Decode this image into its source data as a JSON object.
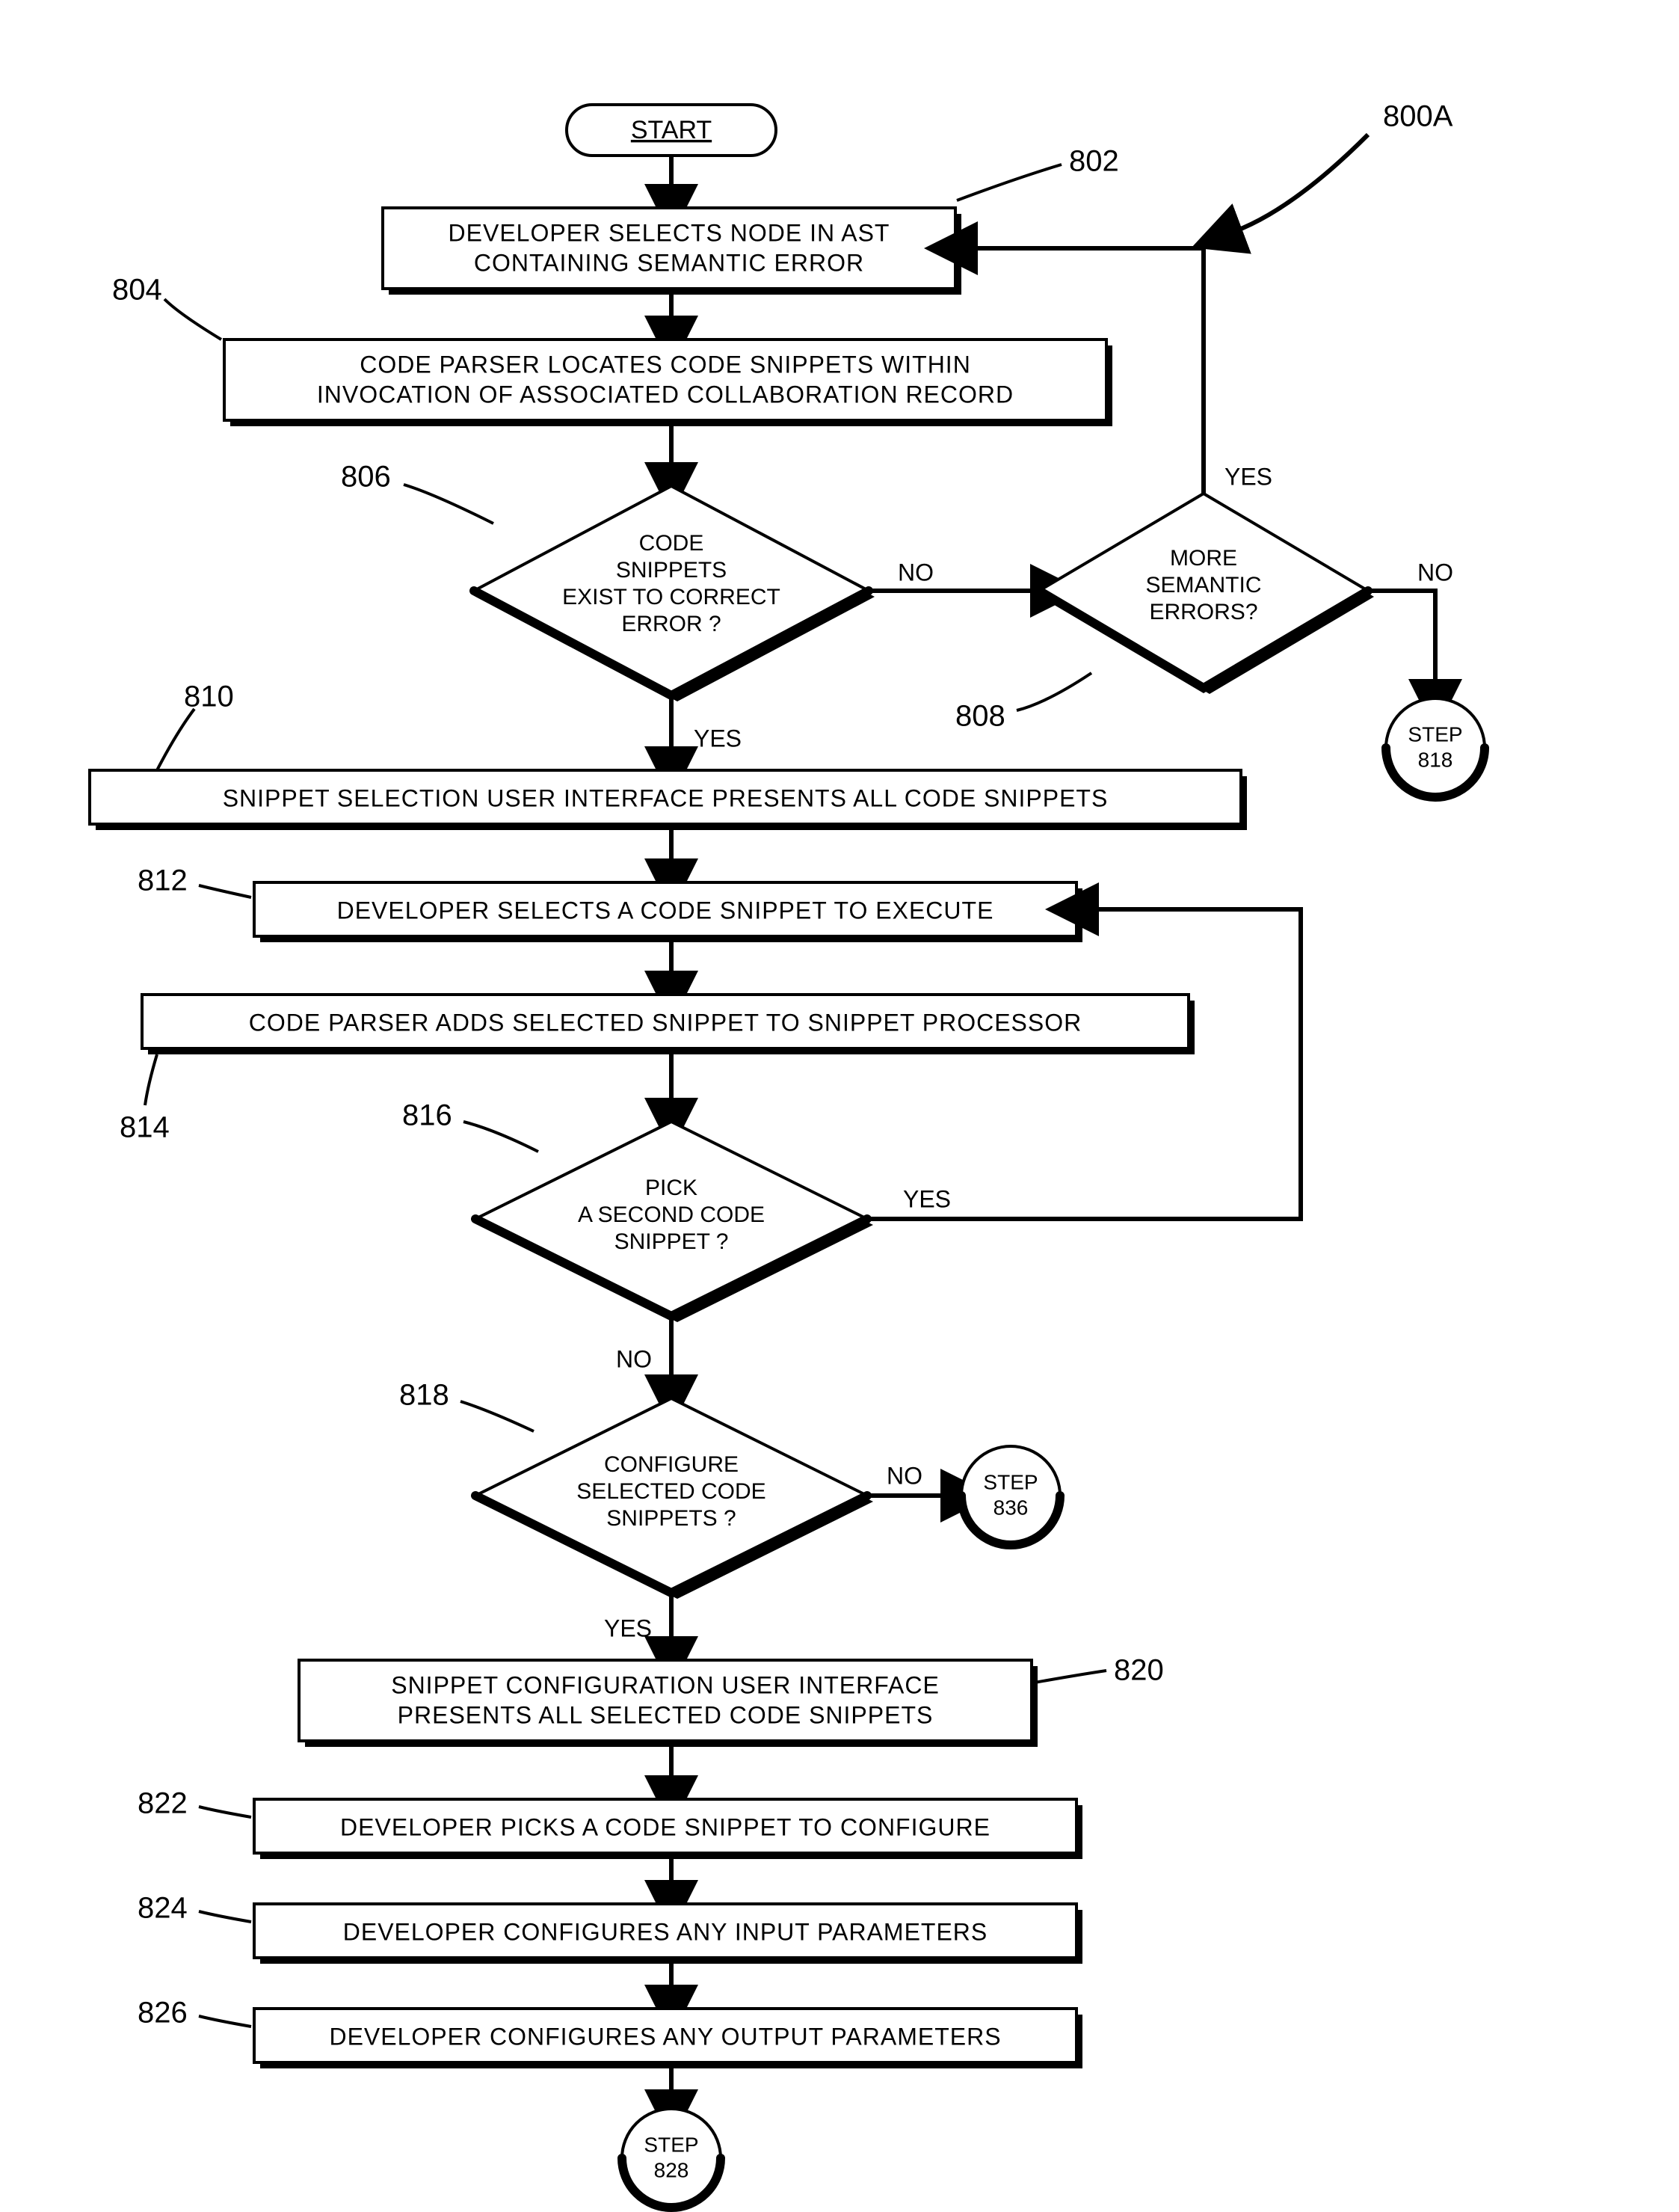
{
  "figure_label": "800A",
  "start": "START",
  "steps": {
    "s802": {
      "ref": "802",
      "lines": [
        "DEVELOPER SELECTS NODE IN AST",
        "CONTAINING SEMANTIC ERROR"
      ]
    },
    "s804": {
      "ref": "804",
      "lines": [
        "CODE PARSER LOCATES CODE SNIPPETS WITHIN",
        "INVOCATION OF ASSOCIATED COLLABORATION RECORD"
      ]
    },
    "s806": {
      "ref": "806",
      "lines": [
        "CODE",
        "SNIPPETS",
        "EXIST TO CORRECT",
        "ERROR ?"
      ]
    },
    "s808": {
      "ref": "808",
      "lines": [
        "MORE",
        "SEMANTIC",
        "ERRORS?"
      ]
    },
    "s810": {
      "ref": "810",
      "lines": [
        "SNIPPET SELECTION USER INTERFACE PRESENTS ALL CODE SNIPPETS"
      ]
    },
    "s812": {
      "ref": "812",
      "lines": [
        "DEVELOPER SELECTS A CODE SNIPPET TO EXECUTE"
      ]
    },
    "s814": {
      "ref": "814",
      "lines": [
        "CODE PARSER ADDS SELECTED SNIPPET TO SNIPPET PROCESSOR"
      ]
    },
    "s816": {
      "ref": "816",
      "lines": [
        "PICK",
        "A SECOND CODE",
        "SNIPPET ?"
      ]
    },
    "s818d": {
      "ref": "818",
      "lines": [
        "CONFIGURE",
        "SELECTED CODE",
        "SNIPPETS ?"
      ]
    },
    "s820": {
      "ref": "820",
      "lines": [
        "SNIPPET CONFIGURATION USER INTERFACE",
        "PRESENTS ALL SELECTED CODE SNIPPETS"
      ]
    },
    "s822": {
      "ref": "822",
      "lines": [
        "DEVELOPER PICKS A CODE SNIPPET TO CONFIGURE"
      ]
    },
    "s824": {
      "ref": "824",
      "lines": [
        "DEVELOPER CONFIGURES ANY INPUT PARAMETERS"
      ]
    },
    "s826": {
      "ref": "826",
      "lines": [
        "DEVELOPER CONFIGURES ANY OUTPUT PARAMETERS"
      ]
    }
  },
  "connectors": {
    "c818": {
      "lines": [
        "STEP",
        "818"
      ]
    },
    "c836": {
      "lines": [
        "STEP",
        "836"
      ]
    },
    "c828": {
      "lines": [
        "STEP",
        "828"
      ]
    }
  },
  "labels": {
    "yes": "YES",
    "no": "NO"
  }
}
